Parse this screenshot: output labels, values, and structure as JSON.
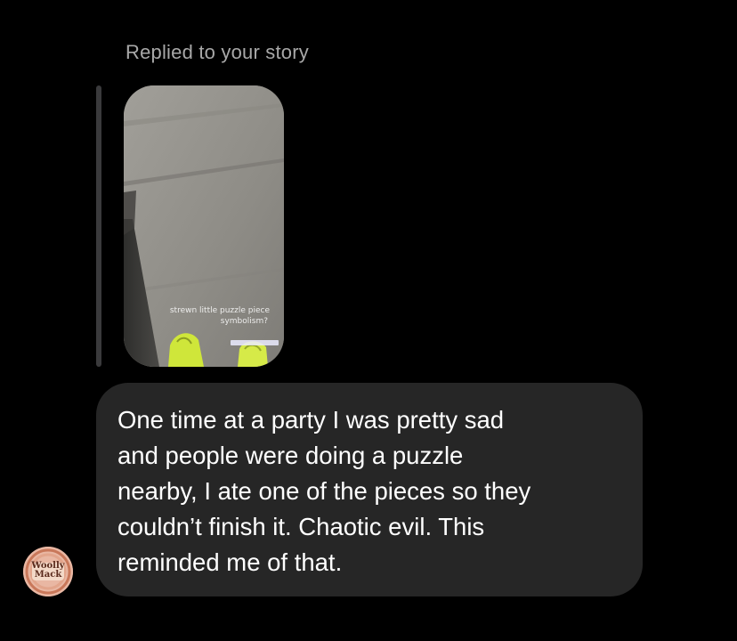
{
  "reply_header": {
    "label": "Replied to your story"
  },
  "story": {
    "caption_line1": "strewn little puzzle piece",
    "caption_line2": "symbolism?"
  },
  "message": {
    "text": "One time at a party I was pretty sad\nand people were doing a puzzle\nnearby, I ate one of the pieces so they\ncouldn’t finish it. Chaotic evil. This\nreminded me of that."
  },
  "sender": {
    "avatar_text": "Woolly\nMack"
  },
  "colors": {
    "background": "#000000",
    "bubble": "#262626",
    "reply_label": "#a8a8a8",
    "sneaker": "#cfe63a"
  }
}
